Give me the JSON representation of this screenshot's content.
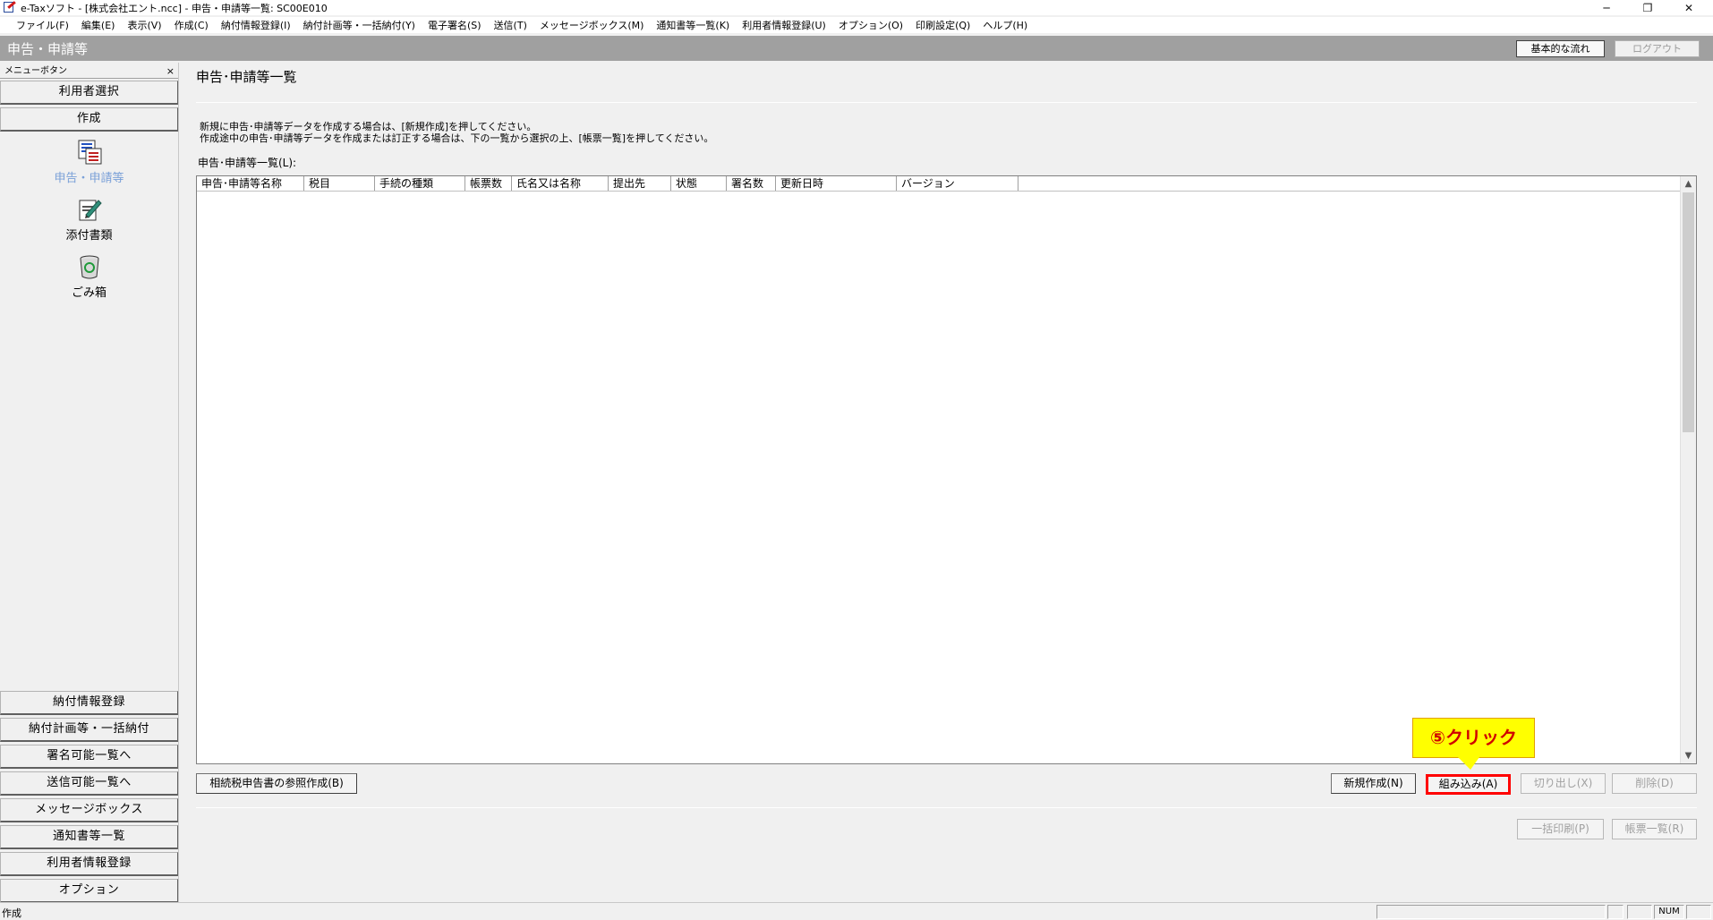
{
  "window": {
    "title": "e-Taxソフト - [株式会社エント.ncc] - 申告・申請等一覧: SC00E010",
    "min": "─",
    "max": "❐",
    "close": "✕"
  },
  "menubar": {
    "items": [
      "ファイル(F)",
      "編集(E)",
      "表示(V)",
      "作成(C)",
      "納付情報登録(I)",
      "納付計画等・一括納付(Y)",
      "電子署名(S)",
      "送信(T)",
      "メッセージボックス(M)",
      "通知書等一覧(K)",
      "利用者情報登録(U)",
      "オプション(O)",
      "印刷設定(Q)",
      "ヘルプ(H)"
    ]
  },
  "header": {
    "title": "申告・申請等",
    "flow_button": "基本的な流れ",
    "logout_button": "ログアウト"
  },
  "sidebar": {
    "header": "メニューボタン",
    "close": "×",
    "top_buttons": [
      "利用者選択",
      "作成"
    ],
    "icons": [
      {
        "label": "申告・申請等",
        "icon": "document-list-icon"
      },
      {
        "label": "添付書類",
        "icon": "attachment-pen-icon"
      },
      {
        "label": "ごみ箱",
        "icon": "recycle-bin-icon"
      }
    ],
    "bottom_buttons": [
      "納付情報登録",
      "納付計画等・一括納付",
      "署名可能一覧へ",
      "送信可能一覧へ",
      "メッセージボックス",
      "通知書等一覧",
      "利用者情報登録",
      "オプション"
    ]
  },
  "main": {
    "title": "申告･申請等一覧",
    "instructions": [
      "新規に申告･申請等データを作成する場合は、[新規作成]を押してください。",
      "作成途中の申告･申請等データを作成または訂正する場合は、下の一覧から選択の上、[帳票一覧]を押してください。"
    ],
    "list_label": "申告･申請等一覧(L):",
    "columns": [
      "申告･申請等名称",
      "税目",
      "手続の種類",
      "帳票数",
      "氏名又は名称",
      "提出先",
      "状態",
      "署名数",
      "更新日時",
      "バージョン"
    ],
    "rows": [],
    "buttons": {
      "souzoku": "相続税申告書の参照作成(B)",
      "new": "新規作成(N)",
      "import": "組み込み(A)",
      "cut": "切り出し(X)",
      "delete": "削除(D)",
      "bulk_print": "一括印刷(P)",
      "form_list": "帳票一覧(R)"
    }
  },
  "callout": {
    "text": "⑤クリック",
    "color": "#ffff00",
    "text_color": "#d00000"
  },
  "statusbar": {
    "text": "作成",
    "num": "NUM"
  }
}
